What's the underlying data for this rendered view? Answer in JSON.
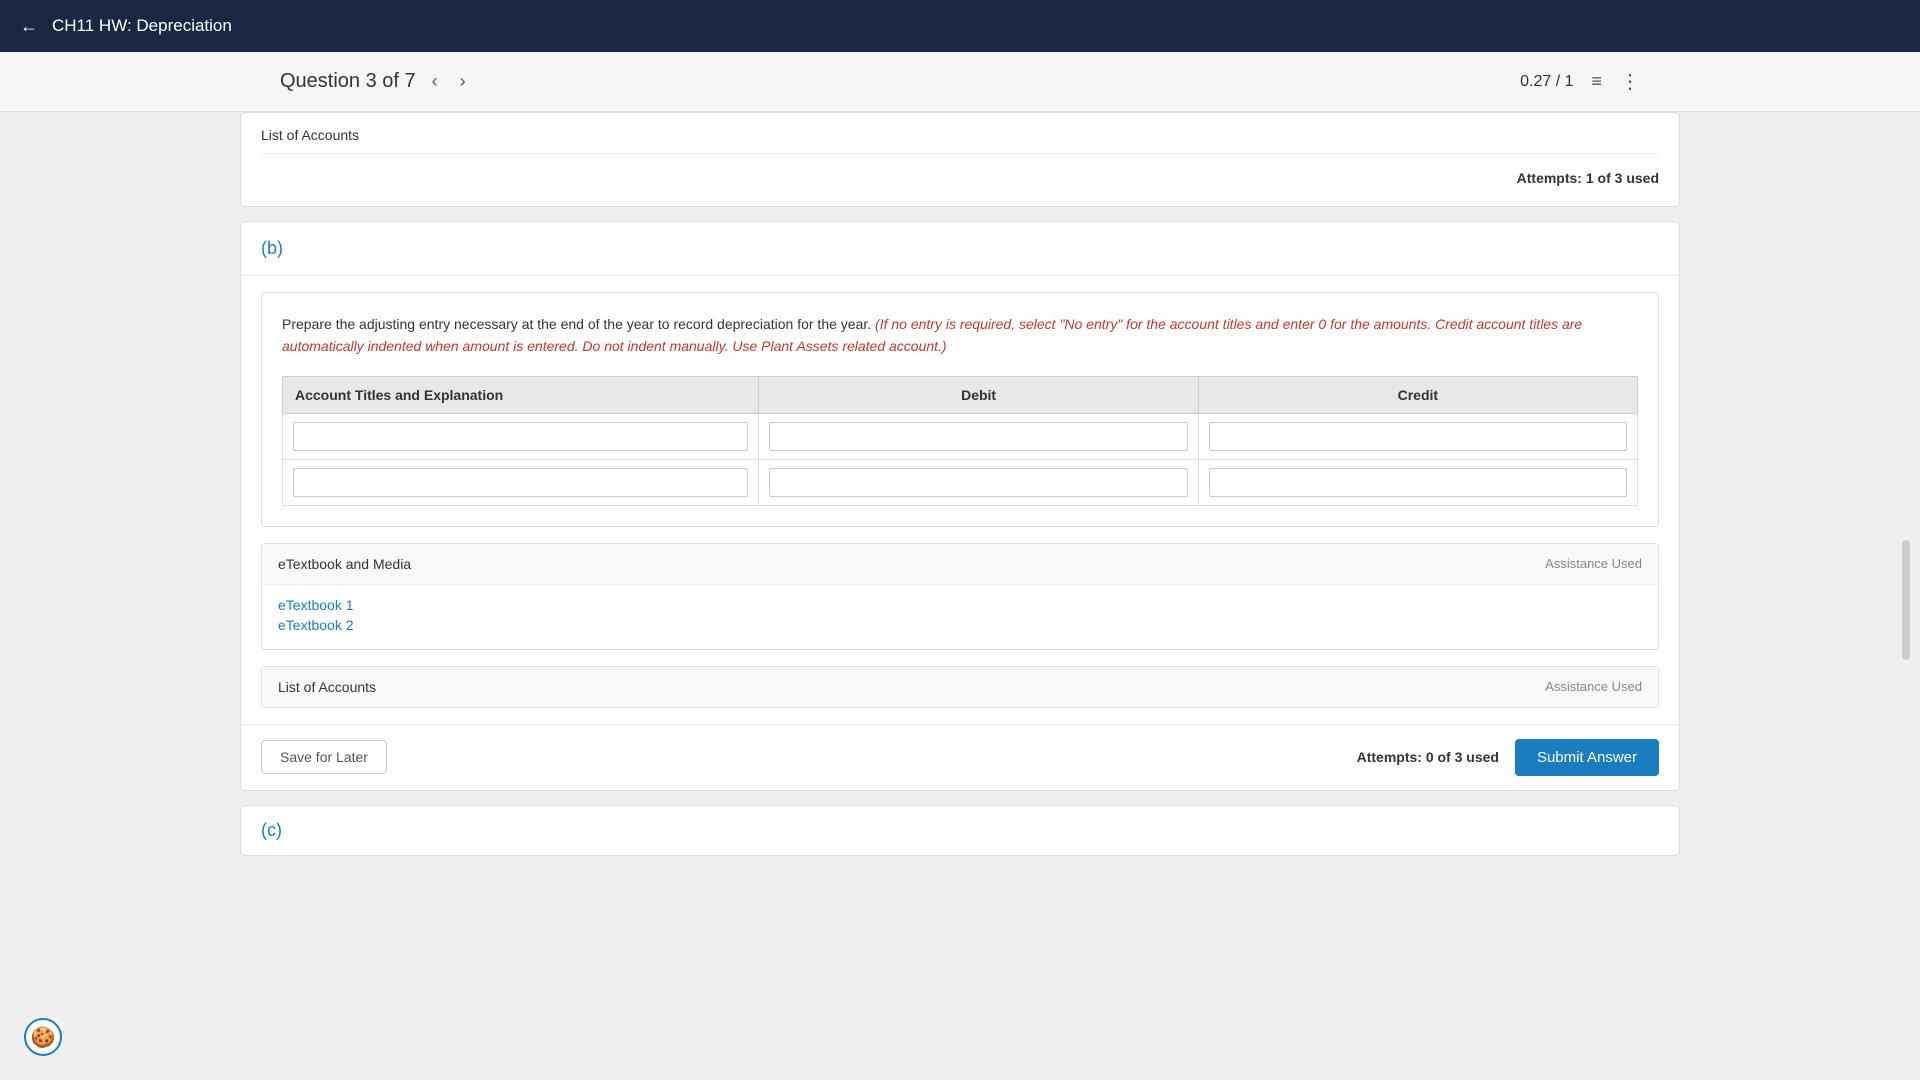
{
  "nav": {
    "back_icon": "←",
    "title": "CH11 HW: Depreciation"
  },
  "subheader": {
    "question_label": "Question 3 of 7",
    "prev_icon": "‹",
    "next_icon": "›",
    "score": "0.27 / 1",
    "list_icon": "≡",
    "more_icon": "⋮"
  },
  "section_top": {
    "list_of_accounts": "List of Accounts",
    "attempts": "Attempts: 1 of 3 used"
  },
  "section_b": {
    "label": "(b)",
    "instruction_plain": "Prepare the adjusting entry necessary at the end of the year to record depreciation for the year.",
    "instruction_italic": "(If no entry is required, select \"No entry\" for the account titles and enter 0 for the amounts. Credit account titles are automatically indented when amount is entered. Do not indent manually. Use Plant Assets related account.)",
    "table": {
      "col1": "Account Titles and Explanation",
      "col2": "Debit",
      "col3": "Credit",
      "rows": [
        {
          "account": "",
          "debit": "",
          "credit": ""
        },
        {
          "account": "",
          "debit": "",
          "credit": ""
        }
      ]
    },
    "etextbook": {
      "title": "eTextbook and Media",
      "assistance": "Assistance Used",
      "links": [
        "eTextbook 1",
        "eTextbook 2"
      ]
    },
    "list_of_accounts": {
      "title": "List of Accounts",
      "assistance": "Assistance Used"
    },
    "footer": {
      "save_later": "Save for Later",
      "attempts": "Attempts: 0 of 3 used",
      "submit": "Submit Answer"
    }
  },
  "section_c": {
    "label": "(c)"
  },
  "cookie_icon": "🍪"
}
